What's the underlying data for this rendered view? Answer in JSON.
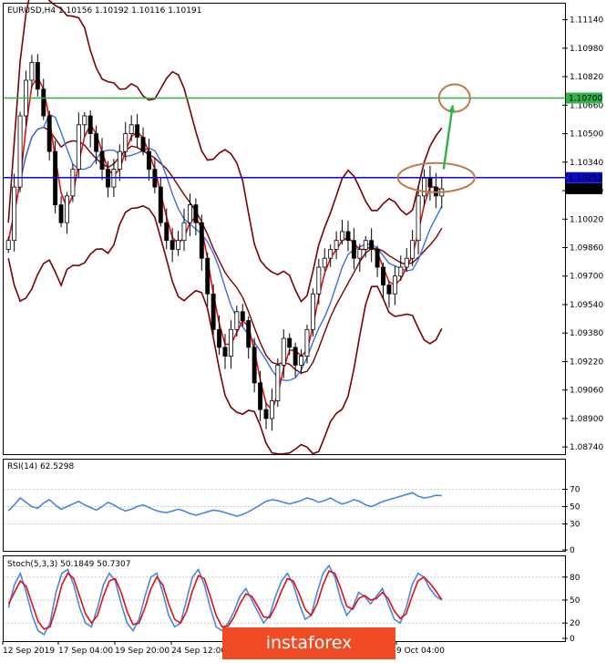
{
  "chart_data": [
    {
      "type": "candlestick",
      "title": "EURUSD,H4 1.10156 1.10192 1.10116 1.10191",
      "symbol": "EURUSD",
      "timeframe": "H4",
      "ohlc": {
        "open": "1.10156",
        "high": "1.10192",
        "low": "1.10116",
        "close": "1.10191"
      },
      "y_ticks": [
        "1.11140",
        "1.10980",
        "1.10820",
        "1.10660",
        "1.10500",
        "1.10340",
        "1.10180",
        "1.10020",
        "1.09860",
        "1.09700",
        "1.09540",
        "1.09380",
        "1.09220",
        "1.09060",
        "1.08900",
        "1.08740"
      ],
      "ylim": [
        1.0871,
        1.1122
      ],
      "horizontal_levels": [
        {
          "value": "1.10700",
          "color": "#2db34a"
        },
        {
          "value": "1.10253",
          "color": "#0a0acd"
        }
      ],
      "current_price": "1.10191",
      "price_path": [
        1.099,
        1.102,
        1.106,
        1.108,
        1.109,
        1.1075,
        1.106,
        1.104,
        1.101,
        1.1,
        1.1015,
        1.103,
        1.1055,
        1.106,
        1.105,
        1.104,
        1.103,
        1.102,
        1.103,
        1.104,
        1.105,
        1.1055,
        1.1048,
        1.104,
        1.103,
        1.102,
        1.1,
        1.099,
        1.0985,
        1.099,
        1.1,
        1.101,
        1.1,
        1.098,
        1.096,
        1.094,
        1.093,
        1.0925,
        1.094,
        1.095,
        1.0945,
        1.093,
        1.091,
        1.0895,
        1.089,
        1.09,
        1.092,
        1.0935,
        1.093,
        1.092,
        1.0925,
        1.094,
        1.096,
        1.0975,
        1.098,
        1.0985,
        1.099,
        1.0995,
        1.099,
        1.098,
        1.0985,
        1.099,
        1.0985,
        1.0975,
        1.0965,
        1.096,
        1.097,
        1.0975,
        1.098,
        1.099,
        1.1015,
        1.1025,
        1.102,
        1.1015,
        1.1019
      ],
      "series": [
        {
          "type": "bollinger_upper",
          "color": "#7a0000"
        },
        {
          "type": "bollinger_middle",
          "color": "#7a0000"
        },
        {
          "type": "bollinger_lower",
          "color": "#7a0000"
        },
        {
          "type": "moving_average",
          "color": "#e01010"
        },
        {
          "type": "moving_average",
          "color": "#3a6fe0"
        }
      ],
      "annotations": [
        {
          "type": "ellipse",
          "color": "#c07a4a",
          "at_price": 1.10253
        },
        {
          "type": "ellipse",
          "color": "#c07a4a",
          "at_price": 1.107
        },
        {
          "type": "arrow",
          "color": "#2db34a",
          "from_price": 1.103,
          "to_price": 1.1066
        }
      ],
      "x_ticks": [
        "12 Sep 2019",
        "17 Sep 04:00",
        "19 Sep 20:00",
        "24 Sep 12:00",
        "9 Oct 04:00"
      ]
    },
    {
      "type": "line",
      "title": "RSI(14) 62.5298",
      "y_ticks": [
        "70",
        "50",
        "30",
        "0"
      ],
      "ylim": [
        0,
        100
      ],
      "levels": [
        70,
        50,
        30
      ],
      "series": [
        {
          "color": "#4a86e0",
          "values": [
            45,
            52,
            60,
            55,
            50,
            48,
            54,
            58,
            52,
            47,
            50,
            53,
            56,
            52,
            49,
            46,
            50,
            55,
            52,
            48,
            45,
            47,
            50,
            52,
            49,
            46,
            44,
            43,
            45,
            47,
            45,
            42,
            40,
            42,
            44,
            46,
            45,
            43,
            41,
            39,
            41,
            44,
            48,
            52,
            56,
            58,
            57,
            55,
            53,
            55,
            57,
            60,
            58,
            55,
            57,
            60,
            56,
            53,
            55,
            58,
            56,
            52,
            50,
            53,
            56,
            58,
            60,
            62,
            64,
            66,
            62,
            60,
            61,
            63,
            62.5
          ]
        }
      ]
    },
    {
      "type": "line",
      "title": "Stoch(5,3,3) 50.1849 50.7307",
      "y_ticks": [
        "80",
        "50",
        "20",
        "0"
      ],
      "ylim": [
        0,
        100
      ],
      "levels": [
        80,
        50,
        20
      ],
      "series": [
        {
          "color": "#4a86e0",
          "values": [
            40,
            70,
            85,
            60,
            30,
            10,
            5,
            20,
            60,
            85,
            90,
            70,
            40,
            20,
            15,
            40,
            70,
            85,
            75,
            45,
            20,
            10,
            25,
            55,
            80,
            85,
            60,
            30,
            15,
            20,
            50,
            80,
            90,
            70,
            40,
            15,
            10,
            20,
            35,
            55,
            65,
            50,
            35,
            20,
            30,
            55,
            75,
            85,
            70,
            45,
            25,
            30,
            60,
            85,
            95,
            80,
            50,
            30,
            40,
            60,
            55,
            45,
            55,
            65,
            45,
            25,
            20,
            40,
            70,
            85,
            80,
            65,
            55,
            50.2
          ]
        },
        {
          "color": "#e01010",
          "values": [
            45,
            60,
            75,
            68,
            45,
            22,
            12,
            15,
            40,
            70,
            85,
            78,
            55,
            32,
            20,
            30,
            55,
            75,
            78,
            60,
            35,
            18,
            20,
            40,
            65,
            80,
            70,
            45,
            25,
            20,
            35,
            62,
            82,
            78,
            55,
            30,
            15,
            16,
            28,
            45,
            58,
            55,
            42,
            28,
            27,
            42,
            62,
            78,
            75,
            58,
            38,
            30,
            45,
            70,
            88,
            85,
            65,
            42,
            38,
            52,
            56,
            50,
            52,
            60,
            52,
            36,
            26,
            32,
            55,
            75,
            80,
            72,
            62,
            50.7
          ]
        }
      ]
    }
  ],
  "watermark": "instaforex"
}
